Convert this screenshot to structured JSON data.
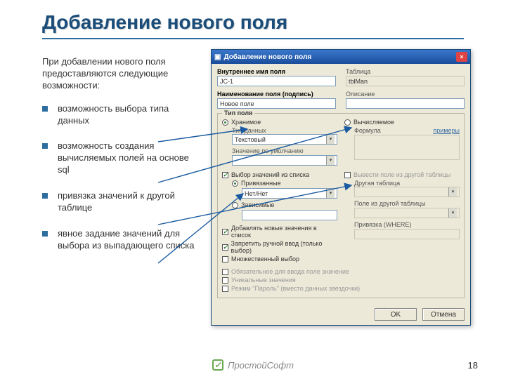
{
  "title": "Добавление нового поля",
  "intro": "При добавлении нового поля предоставляются следующие возможности:",
  "bullets": [
    "возможность выбора типа данных",
    "возможность создания вычисляемых полей на основе sql",
    "привязка значений к другой таблице",
    "явное задание значений для выбора из выпадающего списка"
  ],
  "dialog": {
    "title": "Добавление нового поля",
    "close": "×",
    "left": {
      "internal_name_lbl": "Внутреннее имя поля",
      "internal_name_val": "JC-1",
      "field_caption_lbl": "Наименование поля (подпись)",
      "field_caption_val": "Новое поле",
      "type_group": "Тип поля",
      "radio_stored": "Хранимое",
      "tip_dannyh_lbl": "Тип данных",
      "tip_dannyh_val": "Текстовый",
      "default_lbl": "Значение по умолчанию",
      "check_list": "Выбор значений из списка",
      "radio_values": "Привязанные",
      "values_val": "Нет/Нет",
      "radio_query": "Зависимые",
      "check_addnew": "Добавлять новые значения в список",
      "check_noedit": "Запретить ручной ввод (только выбор)",
      "check_multi": "Множественный выбор",
      "check_obliged": "Обязательное для ввода поле значение",
      "check_unique": "Уникальные значения",
      "check_pass": "Режим \"Пароль\" (вместо данных звездочки)"
    },
    "right": {
      "table_lbl": "Таблица",
      "table_val": "tblMan",
      "desc_lbl": "Описание",
      "radio_calc": "Вычисляемое",
      "formula_lbl": "Формула",
      "formula_hint": "примеры",
      "show_other_check": "Вывести поле из другой таблицы",
      "other_table_lbl": "Другая таблица",
      "other_field_lbl": "Поле из другой таблицы",
      "where_lbl": "Привязка (WHERE)"
    },
    "ok": "OK",
    "cancel": "Отмена"
  },
  "footer": {
    "logo": "ПростойСофт",
    "page": "18"
  }
}
